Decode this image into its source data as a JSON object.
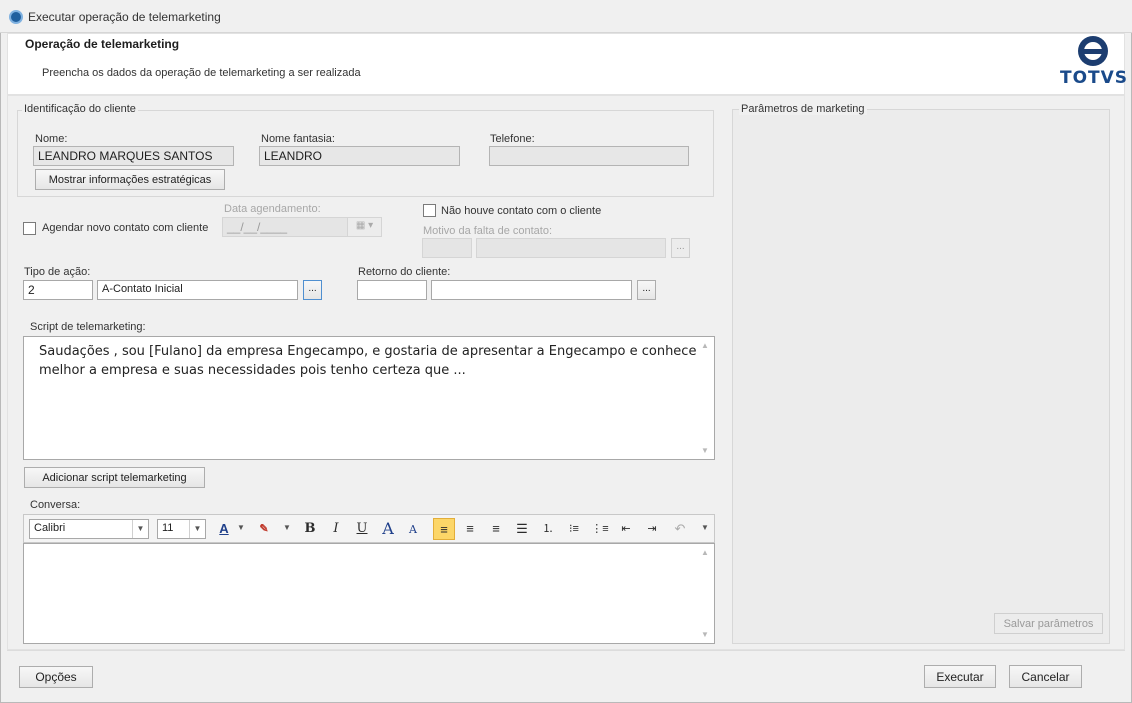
{
  "window": {
    "title": "Executar operação de telemarketing"
  },
  "header": {
    "title": "Operação de telemarketing",
    "subtitle": "Preencha os dados da operação de telemarketing a ser realizada",
    "logo_text": "TOTVS"
  },
  "client": {
    "group_label": "Identificação do cliente",
    "name_label": "Nome:",
    "name_value": "LEANDRO MARQUES SANTOS",
    "fantasy_label": "Nome fantasia:",
    "fantasy_value": "LEANDRO",
    "phone_label": "Telefone:",
    "phone_value": "",
    "strategic_button": "Mostrar informações estratégicas"
  },
  "schedule": {
    "checkbox_label": "Agendar novo contato com cliente",
    "date_label": "Data agendamento:",
    "date_value": "__/__/____"
  },
  "no_contact": {
    "checkbox_label": "Não houve contato com o cliente",
    "reason_label": "Motivo da falta de contato:",
    "ellipsis": "..."
  },
  "action": {
    "label": "Tipo de ação:",
    "code": "2",
    "description": "A-Contato Inicial",
    "ellipsis": "..."
  },
  "return": {
    "label": "Retorno do cliente:",
    "code": "",
    "description": "",
    "ellipsis": "..."
  },
  "script": {
    "label": "Script de telemarketing:",
    "line1": "Saudações , sou [Fulano] da empresa Engecampo, e gostaria de apresentar a Engecampo e conhecer",
    "line2": "melhor a empresa e suas necessidades pois tenho certeza que ...",
    "add_button": "Adicionar script telemarketing"
  },
  "conversation": {
    "label": "Conversa:",
    "font_name": "Calibri",
    "font_size": "11"
  },
  "marketing": {
    "group_label": "Parâmetros de marketing",
    "save_button": "Salvar parâmetros"
  },
  "footer": {
    "options_button": "Opções",
    "execute_button": "Executar",
    "cancel_button": "Cancelar"
  },
  "colors": {
    "logo_blue": "#1a4a8a",
    "highlight": "#fcd668"
  }
}
